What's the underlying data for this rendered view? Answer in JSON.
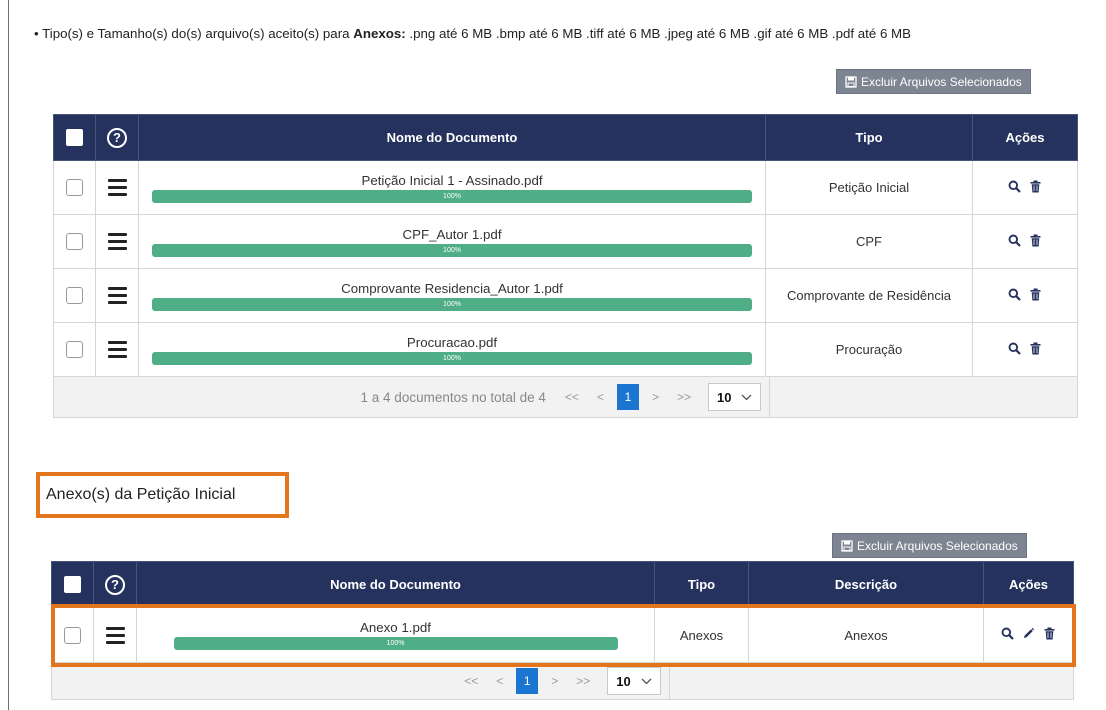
{
  "info": {
    "prefix": "• Tipo(s) e Tamanho(s) do(s) arquivo(s) aceito(s) para ",
    "bold": "Anexos:",
    "suffix": " .png até 6 MB .bmp até 6 MB .tiff até 6 MB .jpeg até 6 MB .gif até 6 MB .pdf até 6 MB"
  },
  "table1": {
    "delete_button": "Excluir Arquivos Selecionados",
    "headers": {
      "help": "?",
      "name": "Nome do Documento",
      "type": "Tipo",
      "actions": "Ações"
    },
    "rows": [
      {
        "file": "Petição Inicial 1 - Assinado.pdf",
        "progress": "100%",
        "type": "Petição Inicial"
      },
      {
        "file": "CPF_Autor 1.pdf",
        "progress": "100%",
        "type": "CPF"
      },
      {
        "file": "Comprovante Residencia_Autor 1.pdf",
        "progress": "100%",
        "type": "Comprovante de Residência"
      },
      {
        "file": "Procuracao.pdf",
        "progress": "100%",
        "type": "Procuração"
      }
    ],
    "pager": {
      "summary": "1 a 4 documentos no total de 4",
      "first": "<<",
      "prev": "<",
      "page": "1",
      "next": ">",
      "last": ">>",
      "page_size": "10"
    }
  },
  "section2": {
    "title": "Anexo(s) da Petição Inicial"
  },
  "table2": {
    "delete_button": "Excluir Arquivos Selecionados",
    "headers": {
      "help": "?",
      "name": "Nome do Documento",
      "type": "Tipo",
      "description": "Descrição",
      "actions": "Ações"
    },
    "rows": [
      {
        "file": "Anexo 1.pdf",
        "progress": "100%",
        "type": "Anexos",
        "description": "Anexos"
      }
    ],
    "pager": {
      "first": "<<",
      "prev": "<",
      "page": "1",
      "next": ">",
      "last": ">>",
      "page_size": "10"
    }
  },
  "colors": {
    "header_bg": "#26325e",
    "progress_green": "#4fae86",
    "active_page": "#1b76d2",
    "highlight": "#e3761c",
    "button_gray": "#7c8591"
  },
  "icons": [
    "help-icon",
    "drag-handle-icon",
    "search-icon",
    "trash-icon",
    "pencil-icon",
    "save-icon",
    "chevron-down-icon"
  ]
}
